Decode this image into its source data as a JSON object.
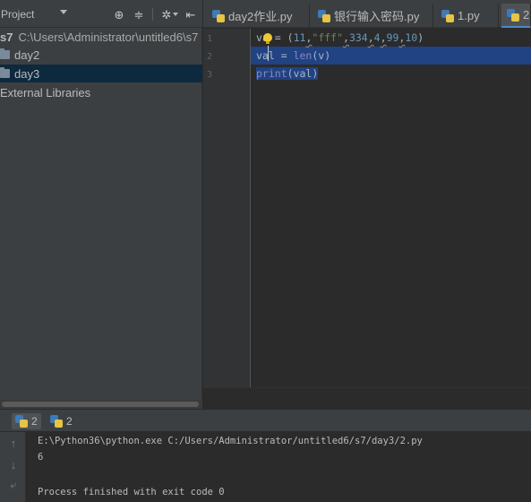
{
  "project_panel": {
    "title": "Project",
    "header_icons": [
      "locate-icon",
      "collapse-icon",
      "settings-icon",
      "hide-icon"
    ],
    "root_name": "s7",
    "root_path": "C:\\Users\\Administrator\\untitled6\\s7",
    "folders": [
      "day2",
      "day3"
    ],
    "selected_folder": "day3",
    "external_libraries": "External Libraries"
  },
  "editor": {
    "tabs": [
      {
        "label": "day2作业.py",
        "active": false
      },
      {
        "label": "银行输入密码.py",
        "active": false
      },
      {
        "label": "1.py",
        "active": false
      },
      {
        "label": "2",
        "active": true
      }
    ],
    "line_numbers": [
      "1",
      "2",
      "3"
    ],
    "code": {
      "line1": {
        "v": "v",
        "a": "a",
        "eq": " = ",
        "open": "(",
        "n1": "11",
        "c1": ",",
        "s1": "\"fff\"",
        "c2": ",",
        "n2": "334",
        "c3": ",",
        "n3": "4",
        "c4": ",",
        "n4": "99",
        "c5": ",",
        "n5": "10",
        "close": ")"
      },
      "line2": {
        "va": "va",
        "rest": "l = ",
        "fn": "len",
        "args": "(v)"
      },
      "line3": {
        "fn": "print",
        "args": "(val)"
      }
    },
    "colors": {
      "number": "#6897bb",
      "string": "#6a8759",
      "builtin": "#8888c6",
      "selection": "#214283"
    }
  },
  "run_panel": {
    "tabs": [
      {
        "label": "2",
        "active": true
      },
      {
        "label": "2",
        "active": false
      }
    ],
    "toolbar_icons": [
      "up-arrow-icon",
      "down-arrow-icon",
      "soft-wrap-icon"
    ],
    "console": [
      "E:\\Python36\\python.exe C:/Users/Administrator/untitled6/s7/day3/2.py",
      "6",
      "Process finished with exit code 0"
    ]
  }
}
